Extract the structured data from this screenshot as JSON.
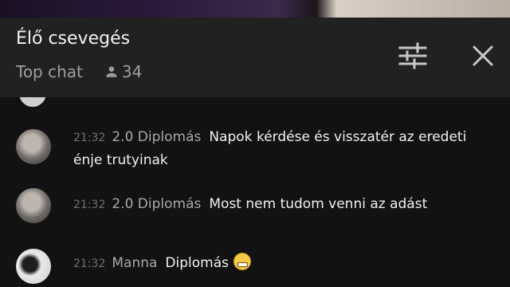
{
  "header": {
    "title": "Élő csevegés",
    "mode_label": "Top chat",
    "viewer_count": "34",
    "icons": {
      "viewers": "person-icon",
      "filter": "tune-sliders-icon",
      "close": "close-icon"
    }
  },
  "messages": [
    {
      "time": "21:32",
      "author": "2.0 Diplomás",
      "text": "Napok kérdése és visszatér az eredeti énje trutyinak"
    },
    {
      "time": "21:32",
      "author": "2.0 Diplomás",
      "text": "Most nem tudom venni az adást"
    },
    {
      "time": "21:32",
      "author": "Manna",
      "text": "Diplomás",
      "emoji": "grinning-face-emoji"
    }
  ],
  "colors": {
    "header_bg": "#212121",
    "chat_bg": "#121212",
    "muted_text": "#9e9e9e"
  }
}
